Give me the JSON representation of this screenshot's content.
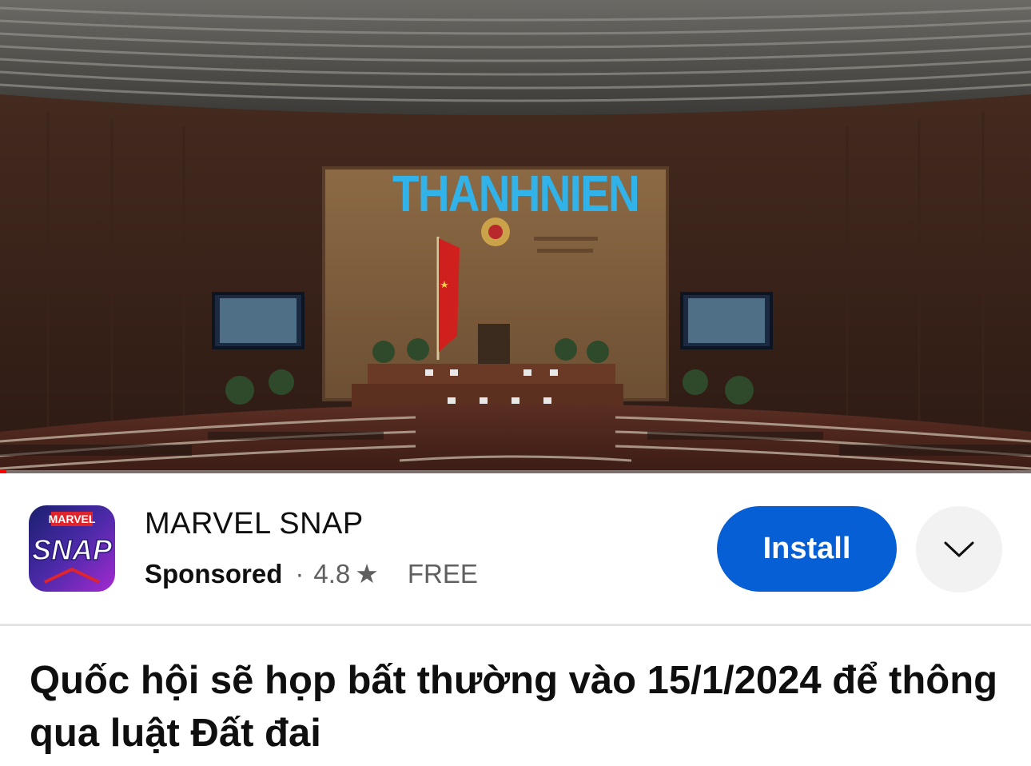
{
  "video": {
    "watermark_text": "THANHNIEN",
    "progress_fraction": 0.006
  },
  "ad": {
    "icon_text_top": "MARVEL",
    "icon_text_main": "SNAP",
    "app_name": "MARVEL SNAP",
    "sponsored_label": "Sponsored",
    "separator": "·",
    "rating": "4.8",
    "star_icon": "★",
    "price": "FREE",
    "install_label": "Install",
    "more_icon": "chevron-down-icon"
  },
  "article": {
    "title": "Quốc hội sẽ họp bất thường vào 15/1/2024 để thông qua luật Đất đai"
  },
  "colors": {
    "install_button": "#065fd4",
    "progress": "#ff0000",
    "watermark": "#31b2e8"
  }
}
